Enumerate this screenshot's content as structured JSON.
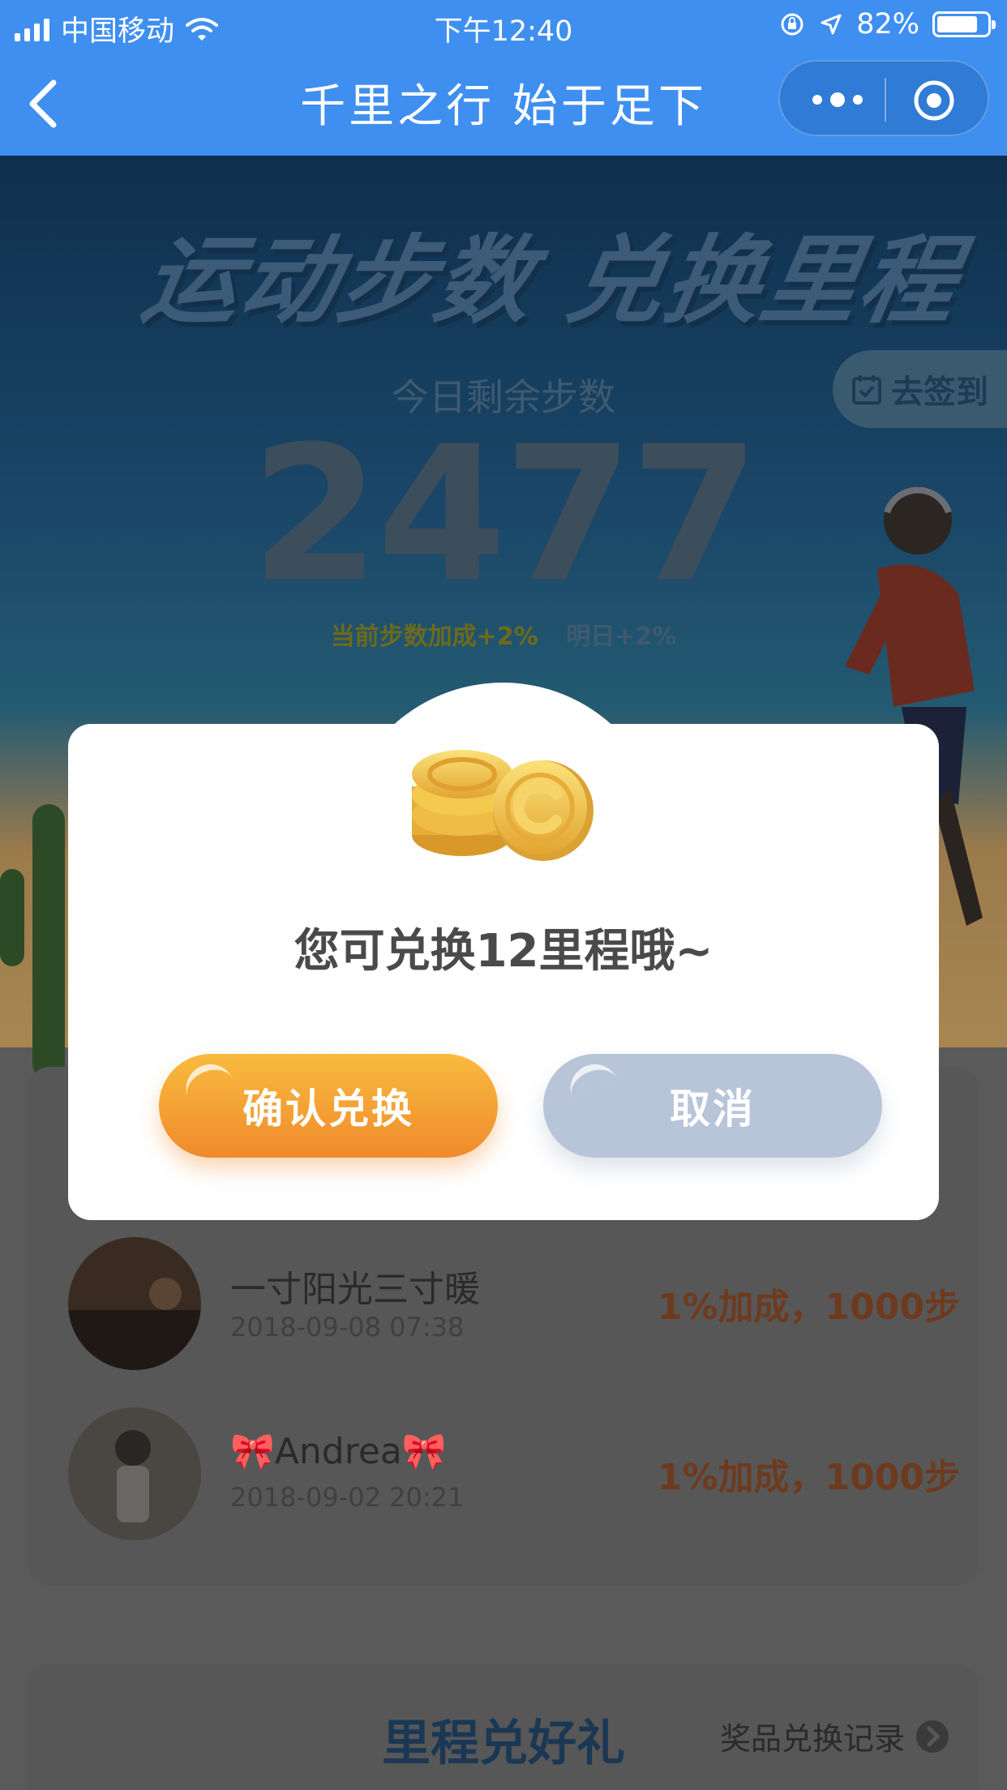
{
  "status_bar": {
    "carrier": "中国移动",
    "time": "下午12:40",
    "battery_percent": "82%",
    "battery_level": 0.82
  },
  "nav": {
    "title": "千里之行 始于足下",
    "icons": [
      "back-chevron-icon",
      "more-dots-icon",
      "close-target-icon"
    ]
  },
  "hero": {
    "banner": "运动步数 兑换里程",
    "checkin_label": "去签到",
    "remain_label": "今日剩余步数",
    "remain_count": "2477",
    "bonus_current": "当前步数加成+2%",
    "bonus_tomorrow": "明日+2%"
  },
  "friends": [
    {
      "name": "一寸阳光三寸暖",
      "time": "2018-09-08 07:38",
      "bonus": "1%加成，1000步"
    },
    {
      "name": "🎀Andrea🎀",
      "time": "2018-09-02 20:21",
      "bonus": "1%加成，1000步"
    }
  ],
  "gifts": {
    "title": "里程兑好礼",
    "record_link": "奖品兑换记录"
  },
  "modal": {
    "message": "您可兑换12里程哦~",
    "confirm_label": "确认兑换",
    "cancel_label": "取消"
  },
  "colors": {
    "nav_blue": "#3f8ff0",
    "confirm_orange": "#f29a2f",
    "cancel_gray": "#b8c4d8",
    "bonus_brown": "#6e3a1e"
  }
}
